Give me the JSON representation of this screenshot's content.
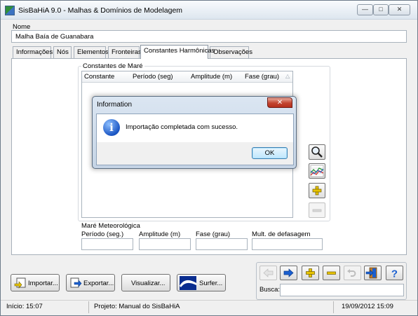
{
  "window": {
    "title": "SisBaHiA 9.0 - Malhas & Domínios de Modelagem",
    "min_glyph": "—",
    "max_glyph": "□",
    "close_glyph": "✕"
  },
  "nome": {
    "label": "Nome",
    "value": "Malha Baía de Guanabara"
  },
  "tabs": [
    {
      "label": "Informações"
    },
    {
      "label": "Nós"
    },
    {
      "label": "Elementos"
    },
    {
      "label": "Fronteiras"
    },
    {
      "label": "Constantes Harmônicas"
    },
    {
      "label": "Observações"
    }
  ],
  "constantes": {
    "group_label": "Constantes de Maré",
    "columns": [
      "Constante",
      "Período (seg)",
      "Amplitude (m)",
      "Fase (grau)"
    ],
    "sort_glyph": "△"
  },
  "meteo": {
    "group_label": "Maré Meteorológica",
    "fields": [
      {
        "label": "Período (seg.)",
        "value": ""
      },
      {
        "label": "Amplitude (m)",
        "value": ""
      },
      {
        "label": "Fase (grau)",
        "value": ""
      },
      {
        "label": "Mult. de defasagem",
        "value": ""
      }
    ]
  },
  "buttons": {
    "importar": "Importar...",
    "exportar": "Exportar...",
    "visualizar": "Visualizar...",
    "surfer": "Surfer..."
  },
  "busca": {
    "label": "Busca:",
    "value": ""
  },
  "status": {
    "inicio": "Início: 15:07",
    "projeto": "Projeto: Manual do SisBaHiA",
    "datetime": "19/09/2012 15:09"
  },
  "dialog": {
    "title": "Information",
    "message": "Importação completada com sucesso.",
    "ok_label": "OK",
    "close_glyph": "✕",
    "icon_glyph": "i"
  },
  "colors": {
    "nav_arrow": "#1a5fd0",
    "add_plus": "#e8c400",
    "remove_minus": "#e8c400",
    "help": "#1a5fd0"
  }
}
